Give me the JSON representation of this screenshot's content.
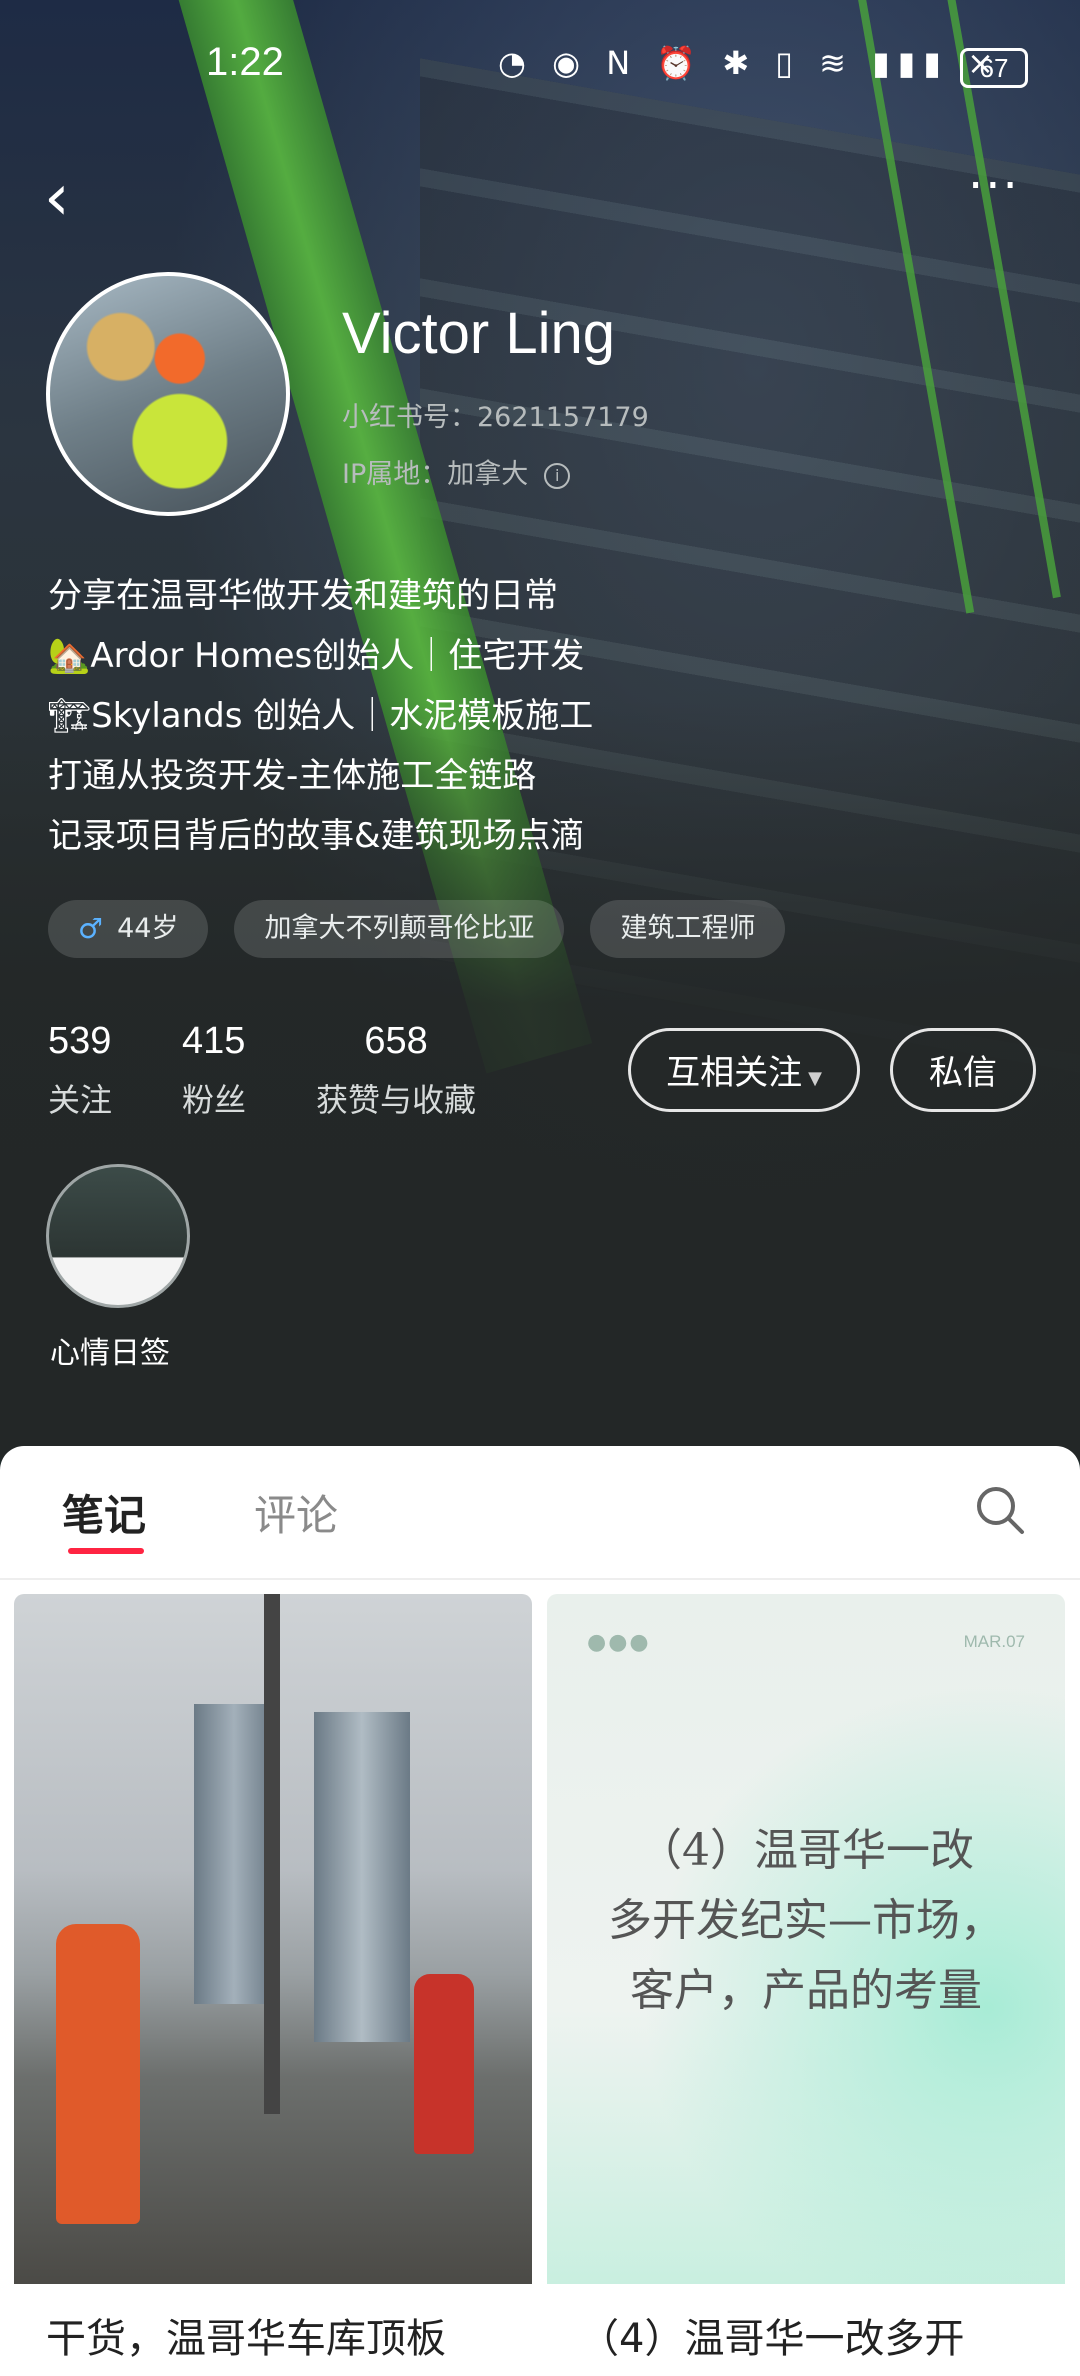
{
  "status_bar": {
    "time": "1:22",
    "icons": "◔ ◉ N ⏰ ✱ ▯ ≋ ▮▮▮ ×",
    "battery": "67"
  },
  "nav": {
    "back": "‹",
    "more": "···"
  },
  "profile": {
    "nickname": "Victor Ling",
    "red_id": "小红书号：2621157179",
    "ip": "IP属地：加拿大",
    "bio": [
      "分享在温哥华做开发和建筑的日常",
      "🏡Ardor Homes创始人｜住宅开发",
      "🏗Skylands 创始人｜水泥模板施工",
      "打通从投资开发-主体施工全链路",
      "记录项目背后的故事&建筑现场点滴"
    ],
    "tags": {
      "age": "44岁",
      "location": "加拿大不列颠哥伦比亚",
      "job": "建筑工程师"
    },
    "stats": [
      {
        "num": "539",
        "label": "关注"
      },
      {
        "num": "415",
        "label": "粉丝"
      },
      {
        "num": "658",
        "label": "获赞与收藏"
      }
    ],
    "follow_label": "互相关注",
    "message_label": "私信",
    "highlight_label": "心情日签"
  },
  "tabs": {
    "notes": "笔记",
    "comments": "评论"
  },
  "posts": [
    {
      "caption": "干货，温哥华车库顶板"
    },
    {
      "caption": "（4）温哥华一改多开",
      "cover_top": "MAR.07",
      "cover_lines": [
        "（4）温哥华一改",
        "多开发纪实—市场，",
        "客户，产品的考量"
      ]
    }
  ],
  "colors": {
    "accent": "#ff2442",
    "dark_bg": "#232727"
  }
}
